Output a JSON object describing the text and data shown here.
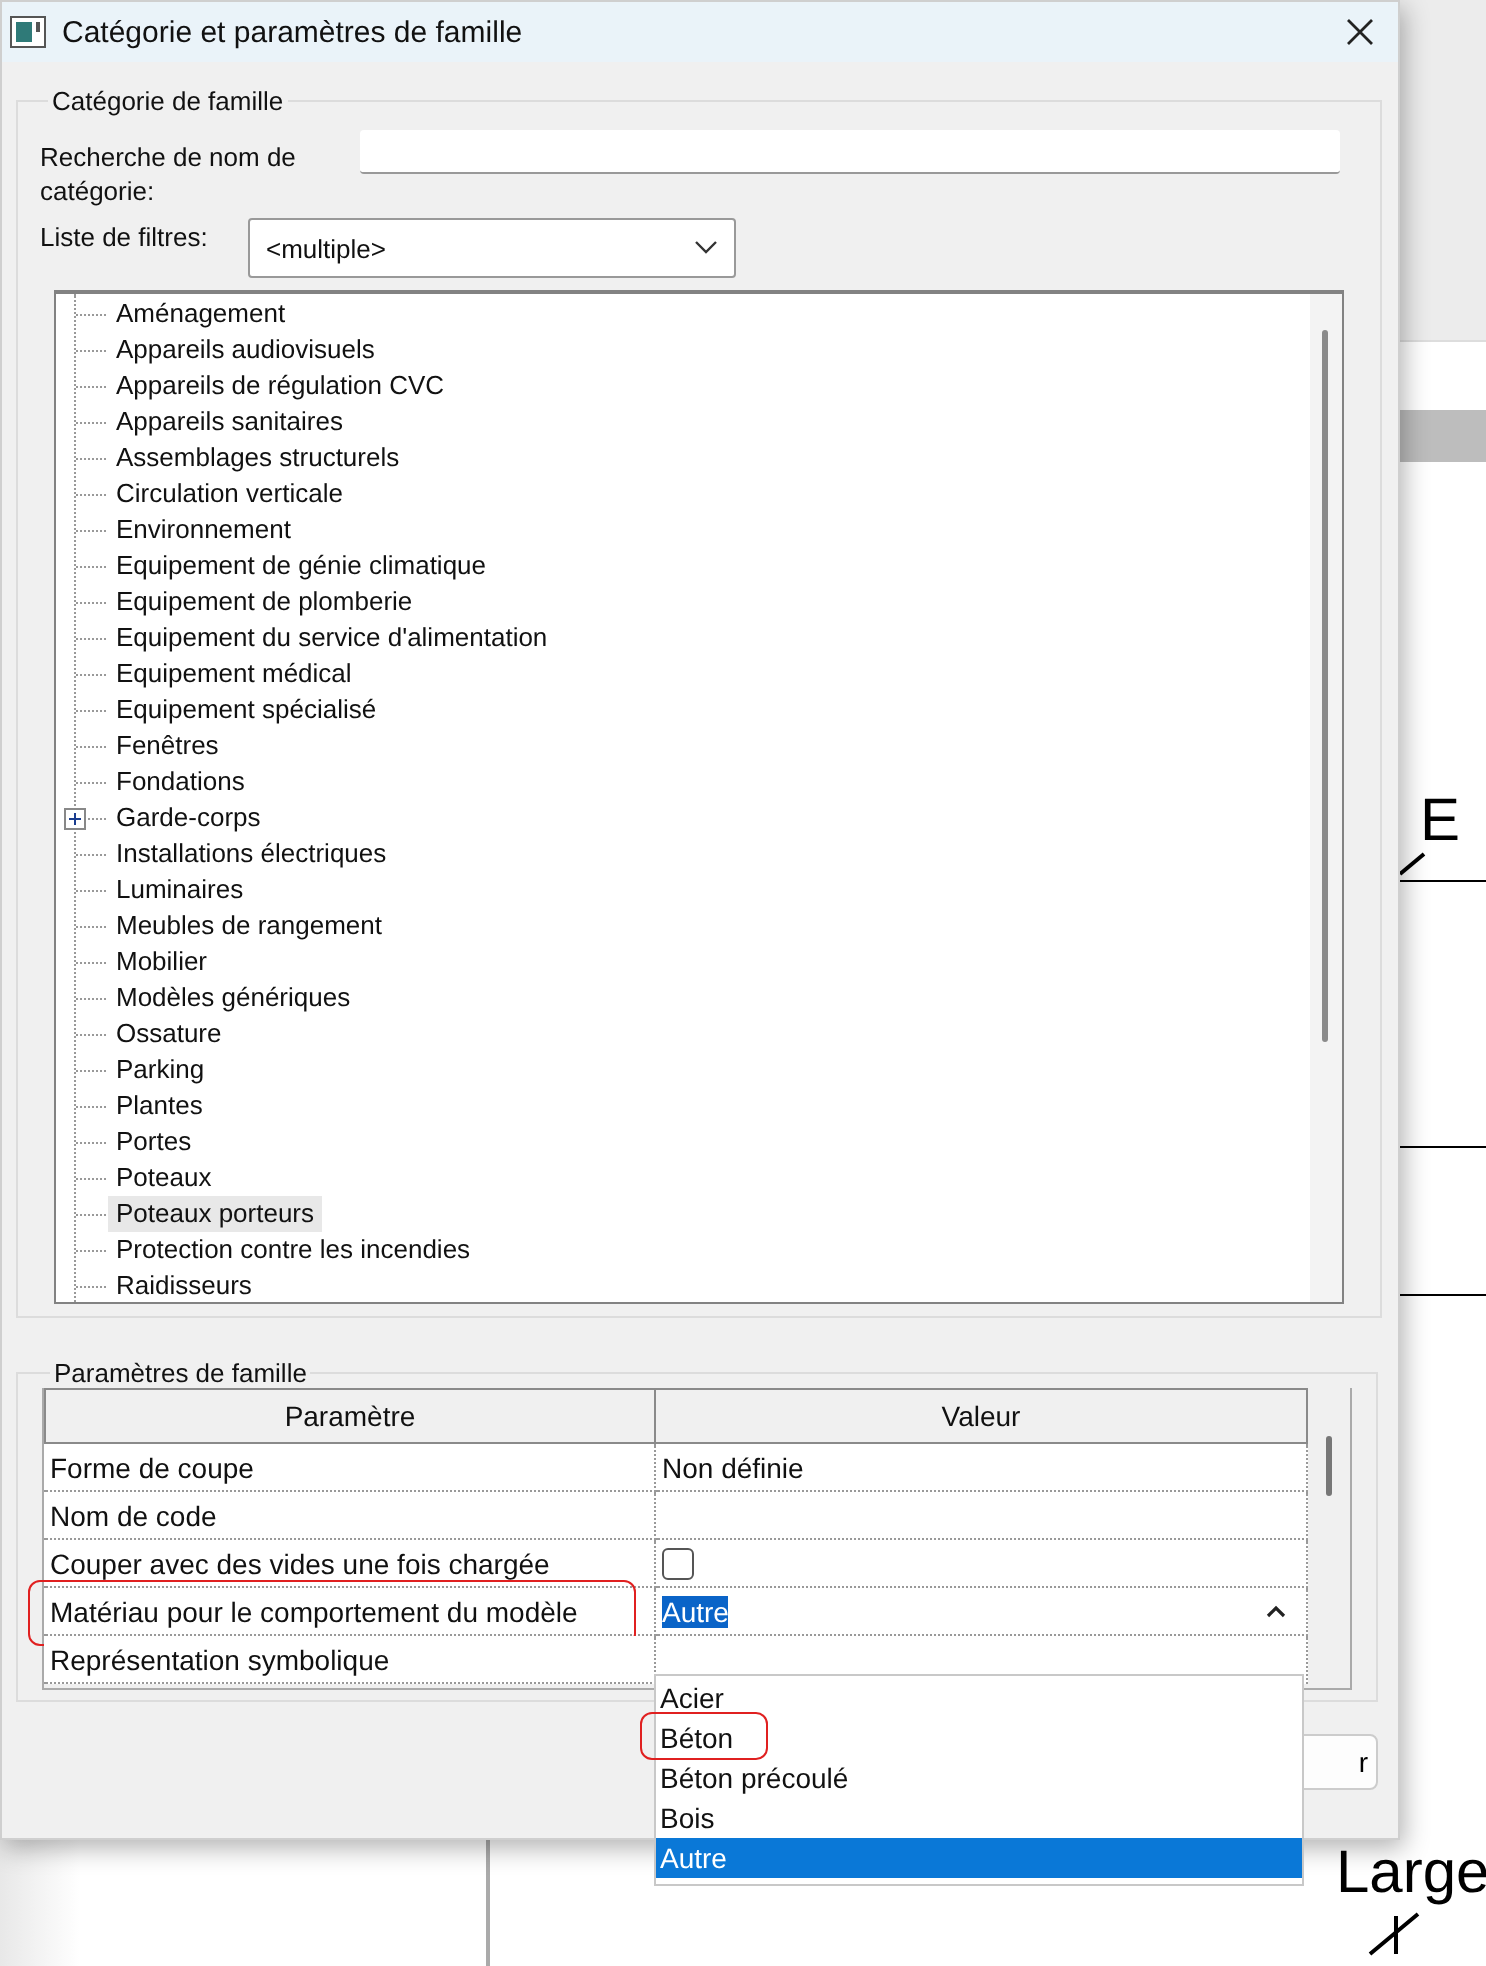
{
  "window": {
    "title": "Catégorie et paramètres de famille"
  },
  "category_group": {
    "title": "Catégorie de famille",
    "search": {
      "label": "Recherche de nom de catégorie:"
    },
    "filter": {
      "label": "Liste de filtres:",
      "value": "<multiple>"
    },
    "tree": [
      {
        "label": "Aménagement",
        "selected": false,
        "expandable": false
      },
      {
        "label": "Appareils audiovisuels",
        "selected": false,
        "expandable": false
      },
      {
        "label": "Appareils de régulation CVC",
        "selected": false,
        "expandable": false
      },
      {
        "label": "Appareils sanitaires",
        "selected": false,
        "expandable": false
      },
      {
        "label": "Assemblages structurels",
        "selected": false,
        "expandable": false
      },
      {
        "label": "Circulation verticale",
        "selected": false,
        "expandable": false
      },
      {
        "label": "Environnement",
        "selected": false,
        "expandable": false
      },
      {
        "label": "Equipement de génie climatique",
        "selected": false,
        "expandable": false
      },
      {
        "label": "Equipement de plomberie",
        "selected": false,
        "expandable": false
      },
      {
        "label": "Equipement du service d'alimentation",
        "selected": false,
        "expandable": false
      },
      {
        "label": "Equipement médical",
        "selected": false,
        "expandable": false
      },
      {
        "label": "Equipement spécialisé",
        "selected": false,
        "expandable": false
      },
      {
        "label": "Fenêtres",
        "selected": false,
        "expandable": false
      },
      {
        "label": "Fondations",
        "selected": false,
        "expandable": false
      },
      {
        "label": "Garde-corps",
        "selected": false,
        "expandable": true
      },
      {
        "label": "Installations électriques",
        "selected": false,
        "expandable": false
      },
      {
        "label": "Luminaires",
        "selected": false,
        "expandable": false
      },
      {
        "label": "Meubles de rangement",
        "selected": false,
        "expandable": false
      },
      {
        "label": "Mobilier",
        "selected": false,
        "expandable": false
      },
      {
        "label": "Modèles génériques",
        "selected": false,
        "expandable": false
      },
      {
        "label": "Ossature",
        "selected": false,
        "expandable": false
      },
      {
        "label": "Parking",
        "selected": false,
        "expandable": false
      },
      {
        "label": "Plantes",
        "selected": false,
        "expandable": false
      },
      {
        "label": "Portes",
        "selected": false,
        "expandable": false
      },
      {
        "label": "Poteaux",
        "selected": false,
        "expandable": false
      },
      {
        "label": "Poteaux porteurs",
        "selected": true,
        "expandable": false
      },
      {
        "label": "Protection contre les incendies",
        "selected": false,
        "expandable": false
      },
      {
        "label": "Raidisseurs",
        "selected": false,
        "expandable": false
      }
    ]
  },
  "parameters_group": {
    "title": "Paramètres de famille",
    "columns": [
      "Paramètre",
      "Valeur"
    ],
    "rows": [
      {
        "name": "Forme de coupe",
        "kind": "text",
        "value": "Non définie",
        "highlighted": false
      },
      {
        "name": "Nom de code",
        "kind": "text",
        "highlighted": false
      },
      {
        "name": "Couper avec des vides une fois chargée",
        "kind": "checkbox",
        "checked": false,
        "highlighted": false
      },
      {
        "name": "Matériau pour le comportement du modèle",
        "kind": "dropdown",
        "value": "Autre",
        "highlighted": true,
        "options": [
          {
            "label": "Acier",
            "selected": false,
            "highlighted": false
          },
          {
            "label": "Béton",
            "selected": false,
            "highlighted": true
          },
          {
            "label": "Béton précoulé",
            "selected": false,
            "highlighted": false
          },
          {
            "label": "Bois",
            "selected": false,
            "highlighted": false
          },
          {
            "label": "Autre",
            "selected": true,
            "highlighted": false
          }
        ]
      },
      {
        "name": "Représentation symbolique",
        "kind": "text",
        "highlighted": false
      }
    ]
  },
  "button": {
    "label": "r"
  },
  "background": {
    "labels": [
      "E",
      "Large"
    ]
  }
}
